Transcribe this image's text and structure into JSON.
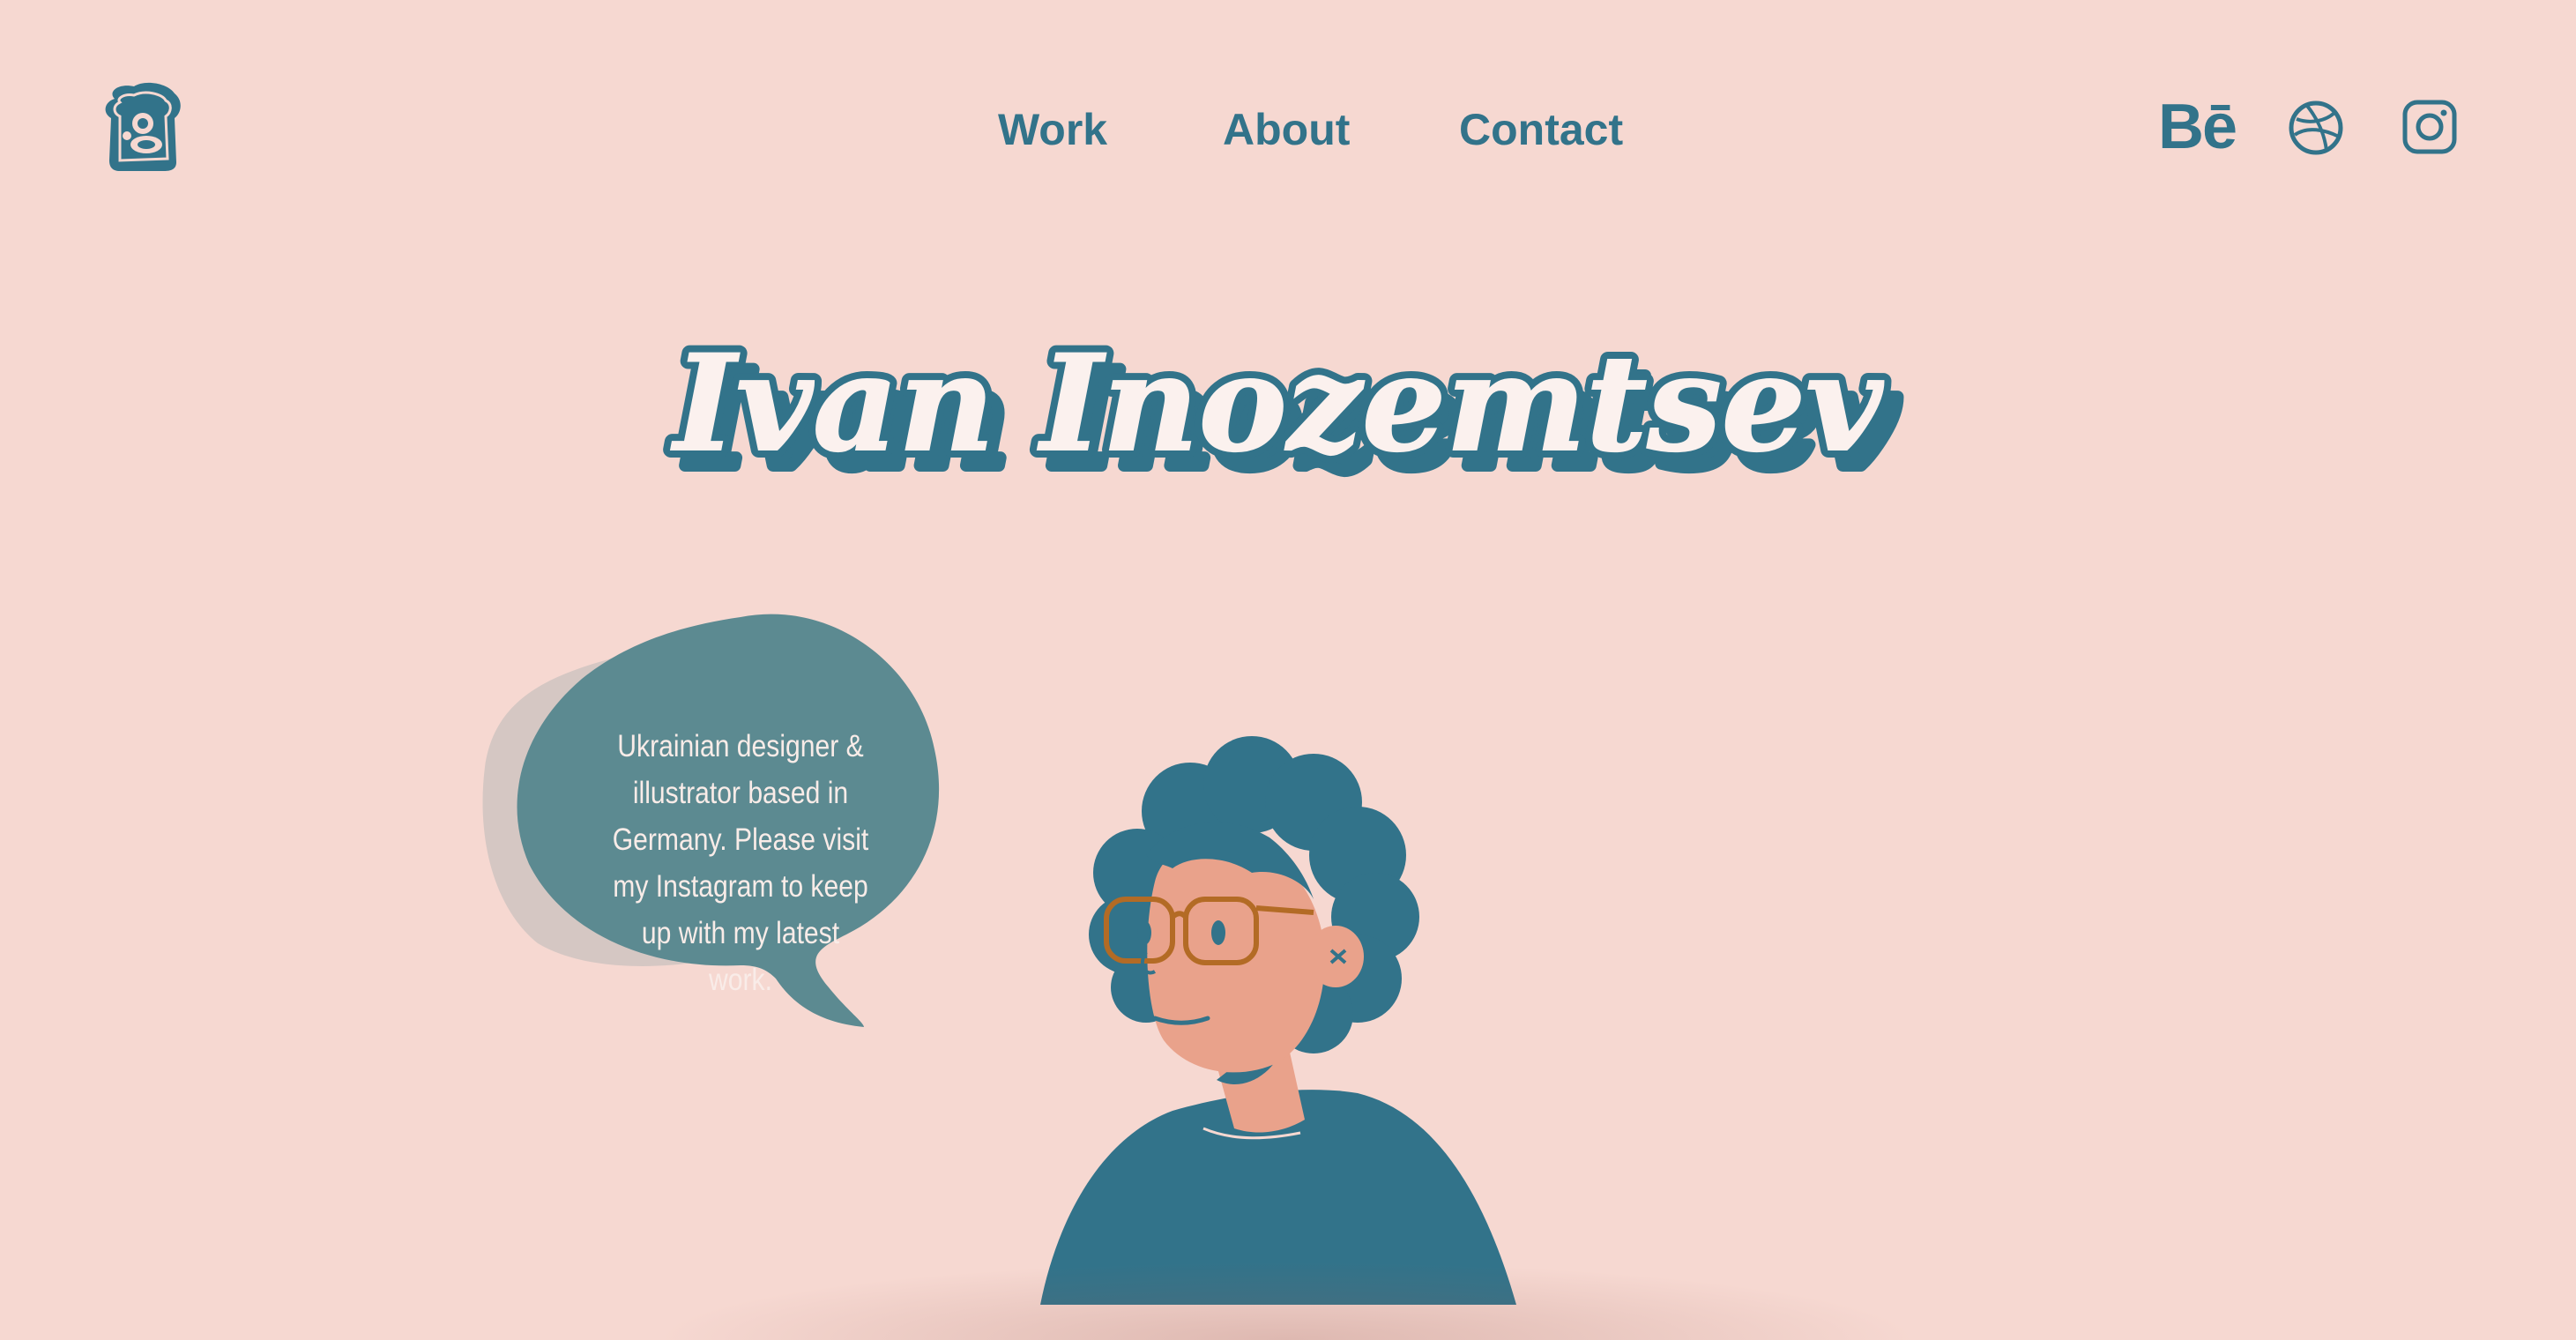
{
  "nav": {
    "items": [
      {
        "label": "Work"
      },
      {
        "label": "About"
      },
      {
        "label": "Contact"
      }
    ]
  },
  "social": {
    "behance_label": "Bē",
    "icons": [
      "behance-icon",
      "dribbble-icon",
      "instagram-icon"
    ]
  },
  "hero": {
    "title": "Ivan Inozemtsev",
    "bubble_text": "Ukrainian designer & illustrator based in Germany. Please visit my Instagram to keep up with my latest work."
  },
  "colors": {
    "background": "#f6d8d1",
    "accent": "#32738a",
    "bubble": "#5c8a91",
    "skin": "#e9a28b",
    "glasses": "#b36b25"
  }
}
